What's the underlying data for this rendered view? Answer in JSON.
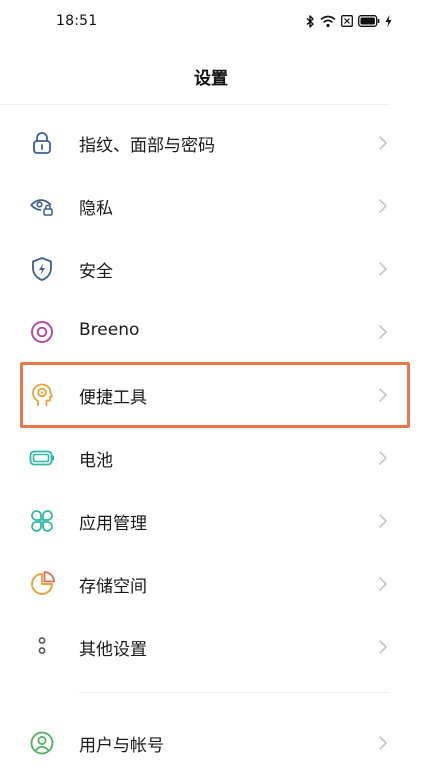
{
  "status_bar": {
    "time": "18:51",
    "icons": [
      "bluetooth-icon",
      "wifi-icon",
      "sim-off-icon",
      "battery-icon",
      "charging-icon"
    ]
  },
  "header": {
    "title": "设置"
  },
  "settings": {
    "items": [
      {
        "label": "指纹、面部与密码",
        "icon": "lock-icon",
        "color": "#3d5f8f"
      },
      {
        "label": "隐私",
        "icon": "eye-lock-icon",
        "color": "#3d5f8f"
      },
      {
        "label": "安全",
        "icon": "shield-bolt-icon",
        "color": "#3d5f8f"
      },
      {
        "label": "Breeno",
        "icon": "breeno-icon",
        "color": "#b24aa3"
      },
      {
        "label": "便捷工具",
        "icon": "head-gear-icon",
        "color": "#e8a23a"
      },
      {
        "label": "电池",
        "icon": "battery-icon",
        "color": "#2fb8a6"
      },
      {
        "label": "应用管理",
        "icon": "apps-grid-icon",
        "color": "#2fb8a6"
      },
      {
        "label": "存储空间",
        "icon": "pie-chart-icon",
        "color": "#e8a23a"
      },
      {
        "label": "其他设置",
        "icon": "more-dots-icon",
        "color": "#555555"
      },
      {
        "label": "用户与帐号",
        "icon": "user-icon",
        "color": "#4fae5f"
      }
    ],
    "highlighted": "便捷工具",
    "highlight_color": "#e8774a"
  }
}
